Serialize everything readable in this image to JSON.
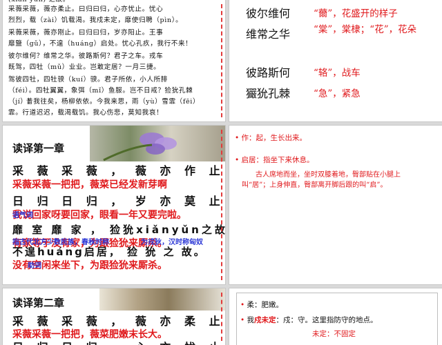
{
  "poem": {
    "lines": [
      "(xian yun) 之故。",
      "采薇采薇，薇亦柔止。曰归曰归，心亦忧止。忧心",
      "烈烈，载（zài）饥载渴。我戍未定，靡使归聘（pìn）。",
      "采薇采薇，薇亦刚止。曰归曰归，岁亦阳止。王事",
      "靡盬（gǔ），不遑（huáng）启处。忧心孔疚，我行不来！",
      "彼尔维何？维常之华。彼路斯何？君子之车。戎车",
      "既驾，四牡（mǔ）业业。岂敢定居？一月三捷。",
      "驾彼四牡，四牡骙（kuí）骙。君子所依，小人所腓",
      "（féi）。四牡翼翼，象弭（mǐ）鱼服。岂不日戒？猃狁孔棘",
      "（jí）！",
      "昔我往矣，杨柳依依。今我来思，雨（yù）雪霏（fēi）",
      "霏。行道迟迟，载渴载饥。我心伤悲，莫知我哀！"
    ]
  },
  "glossary": [
    {
      "term": "彼尔维何",
      "def": "“薾”，花盛开的样子"
    },
    {
      "term": "维常之华",
      "def": "“棠”，棠棣；“花”，花朵"
    },
    {
      "term": "彼路斯何",
      "def": "“辂”，战车"
    },
    {
      "term": "玁狁孔棘",
      "def": "“急”，紧急"
    }
  ],
  "chapter1": {
    "title": "读译第一章",
    "rows": [
      {
        "text": "采 薇 采 薇 ， 薇 亦 作 止 。",
        "style": "black"
      },
      {
        "text": "采薇采薇一把把，薇菜已经发新芽啊",
        "style": "red"
      },
      {
        "text": "日 归 日 归 ， 岁 亦 莫 止 。",
        "style": "black"
      },
      {
        "text": "我说回家呀要回家，眼看一年又要完啦。",
        "style": "red"
      },
      {
        "text": "靡 室 靡 家 ， 猃狁xiǎnyǔn之故。",
        "style": "black"
      },
      {
        "text": "有家等于没有家，为跟猃狁来厮杀。",
        "style": "red"
      },
      {
        "text": "不遑huáng启居， 猃 狁 之 故。",
        "style": "black"
      },
      {
        "text": "没有空闲来坐下，为跟猃狁来厮杀。",
        "style": "red"
      }
    ],
    "overlays": {
      "yi_nian": "语气词",
      "zhou": "指古代北方少数民族，春秋时称",
      "han": "为戎狄，汉时称匈奴",
      "zhu_ci": "助词"
    }
  },
  "notes1": {
    "item1_label": "作：起，生长出来。",
    "item2_label": "启居：指坐下来休息。",
    "item2_body": "古人席地而坐，坐时双膝着地，臀部贴在小腿上叫“居”；上身伸直，臀部离开脚后跟的叫“启”。"
  },
  "chapter2": {
    "title": "读译第二章",
    "rows": [
      {
        "text": "采 薇 采 薇 ， 薇 亦 柔 止 。",
        "style": "black"
      },
      {
        "text": "采薇采薇一把把，薇菜肥嫩末长大。",
        "style": "red"
      },
      {
        "text": "日 归 日 归 ， 心 亦 忧 止 。",
        "style": "black"
      }
    ]
  },
  "notes2": {
    "item1": "柔：肥嫩。",
    "item2_prefix": "我",
    "item2_key": "戍未定",
    "item2_body": "：戍：守。这里指防守的地点。",
    "item3": "未定：不固定"
  }
}
